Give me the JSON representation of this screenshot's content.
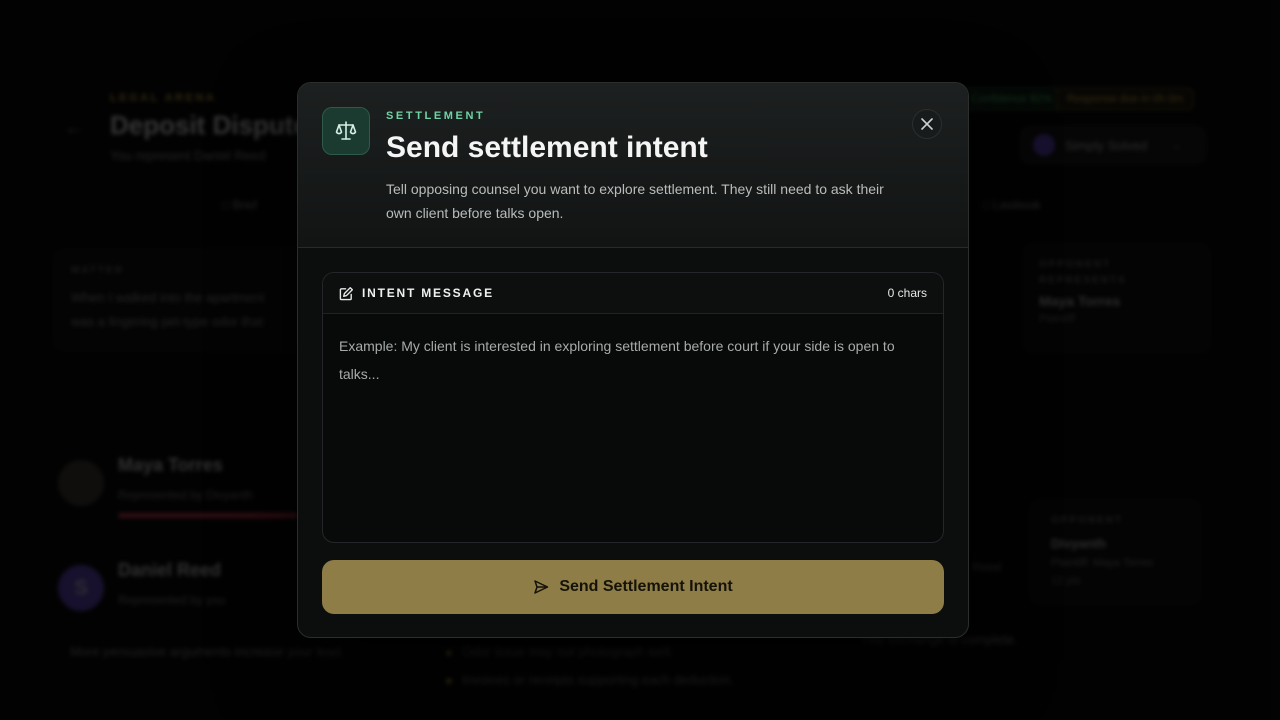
{
  "background": {
    "eyebrow": "LEGAL ARENA",
    "title": "Deposit Dispute",
    "subtitle": "You represent Daniel Reed",
    "pills": {
      "confidence": "Confidence 82%",
      "response": "Response due in 0h 0m"
    },
    "user": "Simply Solved",
    "tabs": {
      "brief": "Brief",
      "lawbook": "Lawbook"
    },
    "matter": {
      "label": "MATTER",
      "text_1": "When I walked into the apartment",
      "text_2": "was a lingering pet-type odor that"
    },
    "opponent_represents": {
      "label": "OPPONENT REPRESENTS",
      "name": "Maya Torres",
      "role": "Plaintiff"
    },
    "parties": [
      {
        "name": "Maya Torres",
        "rep": "Represented by Divyanth",
        "initial": ""
      },
      {
        "name": "Daniel Reed",
        "rep": "Represented by you",
        "initial": "S"
      }
    ],
    "opponent": {
      "label": "OPPONENT",
      "name": "Divyanth",
      "detail": "Plaintiff: Maya Torres",
      "points": "12 pts"
    },
    "side_text": "Reed",
    "footer_note": "More persuasive arguments increase your lead.",
    "bullets": [
      "Odor issue may not photograph well.",
      "Invoices or receipts supporting each deduction."
    ],
    "exchange_note": "This exchange is complete."
  },
  "modal": {
    "eyebrow": "SETTLEMENT",
    "title": "Send settlement intent",
    "description": "Tell opposing counsel you want to explore settlement. They still need to ask their own client before talks open.",
    "field": {
      "label": "INTENT MESSAGE",
      "char_count": "0 chars",
      "value": "",
      "placeholder": "Example: My client is interested in exploring settlement before court if your side is open to talks..."
    },
    "submit_label": "Send Settlement Intent",
    "icons": {
      "header": "scale-icon",
      "close": "close-icon",
      "field": "edit-icon",
      "submit": "send-icon"
    },
    "colors": {
      "accent_green": "#6fd3a6",
      "button_gold": "#8e7d46",
      "modal_bg": "#0c0d0d"
    }
  }
}
